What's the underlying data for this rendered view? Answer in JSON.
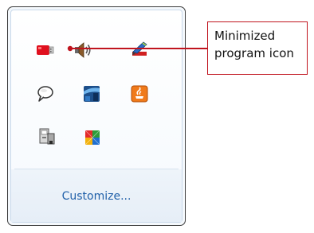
{
  "tray_flyout": {
    "icons": [
      {
        "name": "usb-drive-icon",
        "row": 1,
        "col": 1
      },
      {
        "name": "speaker-volume-icon",
        "row": 1,
        "col": 2
      },
      {
        "name": "pen-app-icon",
        "row": 1,
        "col": 3
      },
      {
        "name": "chat-bubble-icon",
        "row": 2,
        "col": 1
      },
      {
        "name": "blue-app-icon",
        "row": 2,
        "col": 2
      },
      {
        "name": "java-icon",
        "row": 2,
        "col": 3
      },
      {
        "name": "network-adapter-icon",
        "row": 3,
        "col": 1
      },
      {
        "name": "avg-antivirus-icon",
        "row": 3,
        "col": 2
      }
    ],
    "customize_label": "Customize..."
  },
  "callout": {
    "line1": "Minimized",
    "line2": "program icon",
    "color": "#c0141e"
  }
}
